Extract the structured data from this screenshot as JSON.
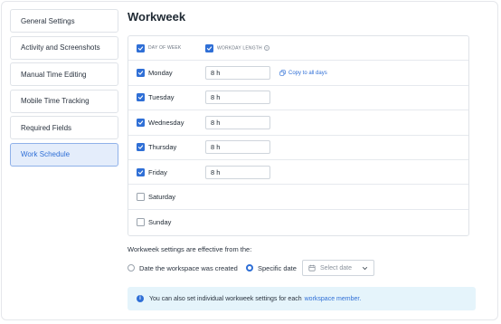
{
  "sidebar": {
    "items": [
      {
        "label": "General Settings",
        "active": false
      },
      {
        "label": "Activity and Screenshots",
        "active": false
      },
      {
        "label": "Manual Time Editing",
        "active": false
      },
      {
        "label": "Mobile Time Tracking",
        "active": false
      },
      {
        "label": "Required Fields",
        "active": false
      },
      {
        "label": "Work Schedule",
        "active": true
      }
    ]
  },
  "main": {
    "title": "Workweek",
    "header": {
      "day_of_week": "DAY OF WEEK",
      "workday_length": "WORKDAY LENGTH",
      "help_glyph": "?"
    },
    "copy_label": "Copy to all days",
    "days": [
      {
        "name": "Monday",
        "checked": true,
        "hours": "8 h"
      },
      {
        "name": "Tuesday",
        "checked": true,
        "hours": "8 h"
      },
      {
        "name": "Wednesday",
        "checked": true,
        "hours": "8 h"
      },
      {
        "name": "Thursday",
        "checked": true,
        "hours": "8 h"
      },
      {
        "name": "Friday",
        "checked": true,
        "hours": "8 h"
      },
      {
        "name": "Saturday",
        "checked": false,
        "hours": ""
      },
      {
        "name": "Sunday",
        "checked": false,
        "hours": ""
      }
    ],
    "effective_text": "Workweek settings are effective from the:",
    "radio_workspace": "Date the workspace was created",
    "radio_specific": "Specific date",
    "date_placeholder": "Select date",
    "info_text": "You can also set individual workweek settings for each",
    "info_link": "workspace member.",
    "info_glyph": "i"
  },
  "colors": {
    "accent": "#2f6fd6",
    "active_bg": "#e4edfb",
    "info_bg": "#e5f4fb"
  }
}
